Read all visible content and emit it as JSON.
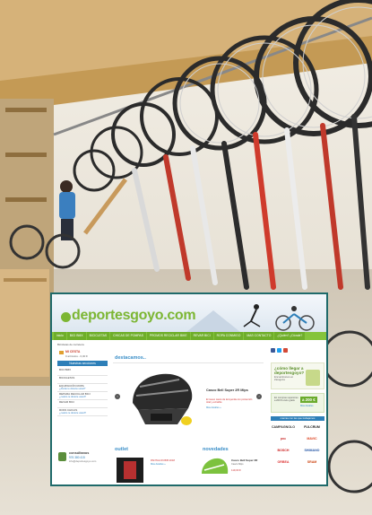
{
  "website": {
    "logo": "deportesgoyo.com",
    "nav": [
      "inicio",
      "BICI BMX",
      "BICICLETAS",
      "CHICAS DE POMPAS",
      "PROMOS RECICLAR BIKE",
      "REVAR BICI",
      "ROPA CONMIGO",
      "MAS CONTACTO",
      "¿Quién? ¿Dónde?"
    ],
    "home_line": "Bicicletas de carretera",
    "cart": {
      "title": "MI CESTA",
      "subtitle": "0 artículos - 0,00 €"
    },
    "menu_header": "Nuestras secciones",
    "menu": [
      {
        "label": "BICI BMX",
        "sub": ""
      },
      {
        "label": "BICICLETAS",
        "sub": ""
      },
      {
        "label": "EQUIPACIÓN ROPA",
        "sub": "¿dónde te divierte usted?"
      },
      {
        "label": "REPARA RECICLAR BICI",
        "sub": "¿cuánto te divierte usted?"
      },
      {
        "label": "REVAR BICI",
        "sub": ""
      },
      {
        "label": "ROPA CHICAS",
        "sub": "¿cuánto te divierte usted?"
      }
    ],
    "contact": {
      "title": "consúltanos",
      "phone": "976 380 415",
      "email": "info@deportesgoyo.com"
    },
    "featured": {
      "title": "destacamos..",
      "product": "Casco Bell Super 2R Mips",
      "description": "El nuevo casco de la leyenda con protección total y extraíble",
      "link": "Más detalles »"
    },
    "outlet": {
      "title": "outlet",
      "text": "PANTALON BIB 2018",
      "link": "Más detalles »"
    },
    "news": {
      "title": "novedades",
      "name": "Casco Bell Super 2R",
      "sub": "Casco Mips",
      "price": "119,00 €"
    },
    "promo1": {
      "question": "¿cómo llegar a deportesgoyo?",
      "sub": "Encuéntranos en Zaragoza"
    },
    "promo2": {
      "text": "En compras superiores a 200 € envío gratis",
      "amount": "a 200 €",
      "link": "Más detalles"
    },
    "brands_header": "marcas con las que trabajamos",
    "brands": [
      "CAMPAGNOLO",
      "FULCRUM",
      "pnc",
      "MAVIC",
      "BOSCH",
      "SHIMANO",
      "ORBEA",
      "SRAM"
    ],
    "colors": {
      "green": "#85c43c",
      "blue": "#2d7fb8",
      "frame": "#1f6a6a"
    }
  }
}
